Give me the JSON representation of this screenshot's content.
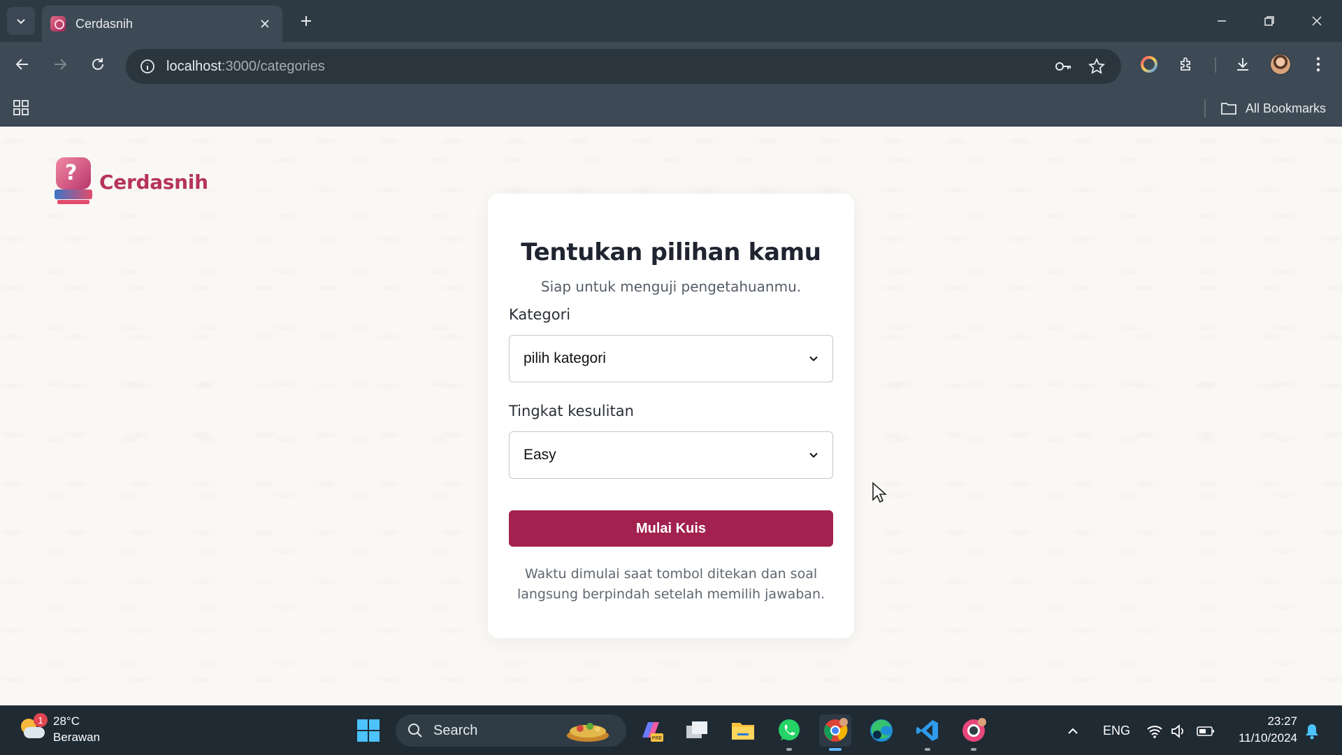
{
  "browser": {
    "tab_title": "Cerdasnih",
    "url_host": "localhost",
    "url_path": ":3000/categories",
    "bookmarks_label": "All Bookmarks"
  },
  "page": {
    "logo_text": "Cerdasnih",
    "title": "Tentukan pilihan kamu",
    "subtitle": "Siap untuk menguji pengetahuanmu.",
    "category_label": "Kategori",
    "category_value": "pilih kategori",
    "difficulty_label": "Tingkat kesulitan",
    "difficulty_value": "Easy",
    "start_button": "Mulai Kuis",
    "note": "Waktu dimulai saat tombol ditekan dan soal langsung berpindah setelah memilih jawaban.",
    "accent_color": "#a2214f"
  },
  "taskbar": {
    "weather_temp": "28°C",
    "weather_desc": "Berawan",
    "weather_badge": "1",
    "search_label": "Search",
    "language": "ENG",
    "time": "23:27",
    "date": "11/10/2024",
    "apps": [
      "start-icon",
      "search",
      "copilot-icon",
      "task-view-icon",
      "file-explorer-icon",
      "whatsapp-icon",
      "chrome-icon",
      "edge-icon",
      "vscode-icon",
      "chrome-profile-icon"
    ]
  }
}
